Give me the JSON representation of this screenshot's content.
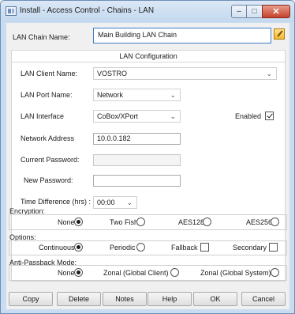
{
  "window": {
    "title": "Install - Access Control - Chains - LAN",
    "minimize_glyph": "–",
    "maximize_glyph": "□",
    "close_glyph": "✕"
  },
  "chain": {
    "label": "LAN Chain Name:",
    "value": "Main Building LAN Chain"
  },
  "config": {
    "header": "LAN Configuration",
    "client_name_label": "LAN Client Name:",
    "client_name_value": "VOSTRO",
    "port_name_label": "LAN Port Name:",
    "port_name_value": "Network",
    "interface_label": "LAN Interface",
    "interface_value": "CoBox/XPort",
    "enabled_label": "Enabled",
    "enabled_checked": true,
    "network_address_label": "Network Address",
    "network_address_value": "10.0.0.182",
    "current_password_label": "Current Password:",
    "current_password_value": "",
    "new_password_label": "New Password:",
    "new_password_value": "",
    "time_diff_label": "Time Difference (hrs) :",
    "time_diff_value": "00:00",
    "dropdown_arrow": "⌄"
  },
  "encryption": {
    "label": "Encryption:",
    "options": [
      "None",
      "Two Fish",
      "AES128",
      "AES256"
    ],
    "selected": "None"
  },
  "options": {
    "label": "Options:",
    "continuous": "Continuous",
    "periodic": "Periodic",
    "fallback": "Fallback",
    "secondary": "Secondary",
    "selected": "Continuous",
    "fallback_checked": false,
    "secondary_checked": false
  },
  "antipassback": {
    "label": "Anti-Passback Mode:",
    "options": [
      "None",
      "Zonal (Global Client)",
      "Zonal (Global System)"
    ],
    "selected": "None"
  },
  "buttons": {
    "copy": "Copy",
    "delete": "Delete",
    "notes": "Notes",
    "help": "Help",
    "ok": "OK",
    "cancel": "Cancel"
  },
  "icons": {
    "app": "chain-app-icon",
    "edit": "edit-notepad-icon"
  }
}
